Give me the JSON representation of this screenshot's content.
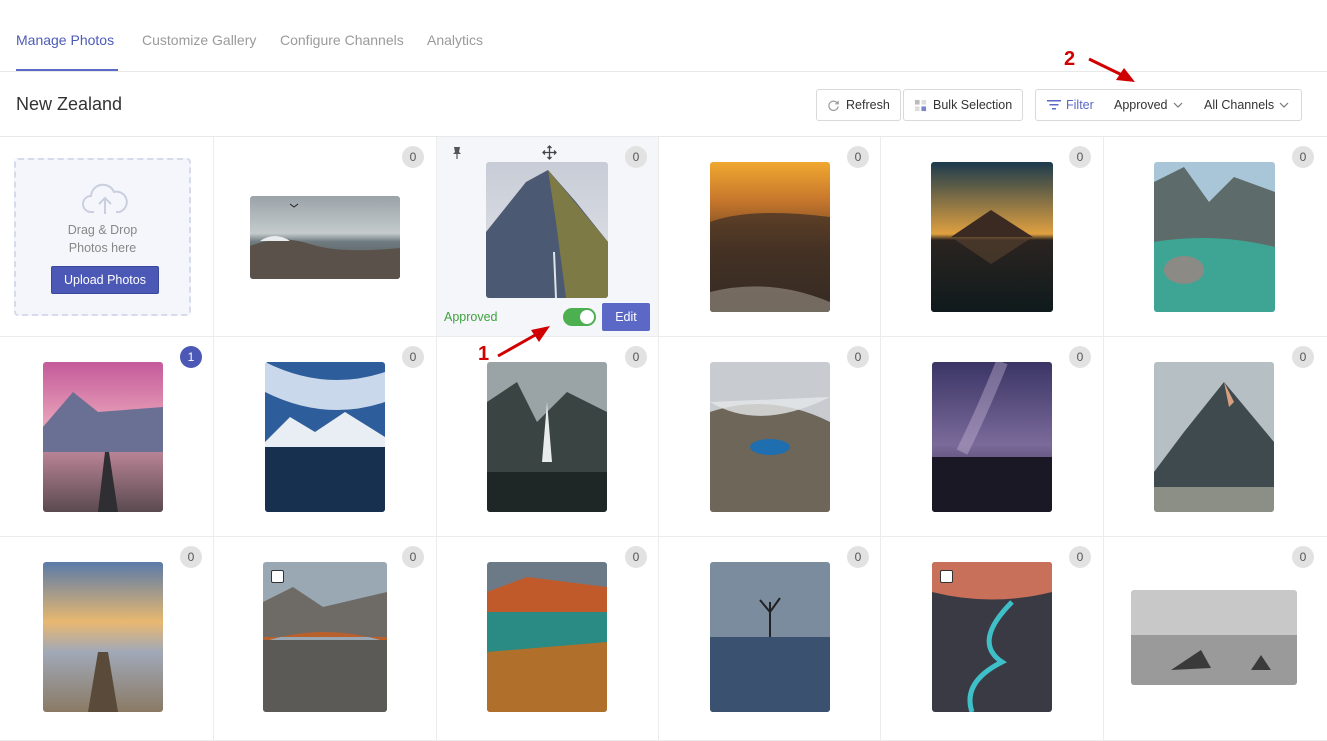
{
  "tabs": [
    "Manage Photos",
    "Customize Gallery",
    "Configure Channels",
    "Analytics"
  ],
  "header": {
    "title": "New Zealand",
    "refresh_label": "Refresh",
    "bulk_label": "Bulk Selection",
    "filter_label": "Filter",
    "status_value": "Approved",
    "channel_value": "All Channels"
  },
  "upload": {
    "line1": "Drag & Drop",
    "line2": "Photos here",
    "button": "Upload Photos"
  },
  "selected_photo": {
    "status": "Approved",
    "toggle_on": true,
    "edit_label": "Edit"
  },
  "badges": [
    "0",
    "0",
    "0",
    "0",
    "0",
    "1",
    "0",
    "0",
    "0",
    "0",
    "0",
    "0",
    "0",
    "0",
    "0",
    "0",
    "0"
  ],
  "annotations": {
    "one": "1",
    "two": "2"
  },
  "colors": {
    "accent": "#4b58b5",
    "approved": "#3fa33f",
    "annotation": "#d10000"
  }
}
